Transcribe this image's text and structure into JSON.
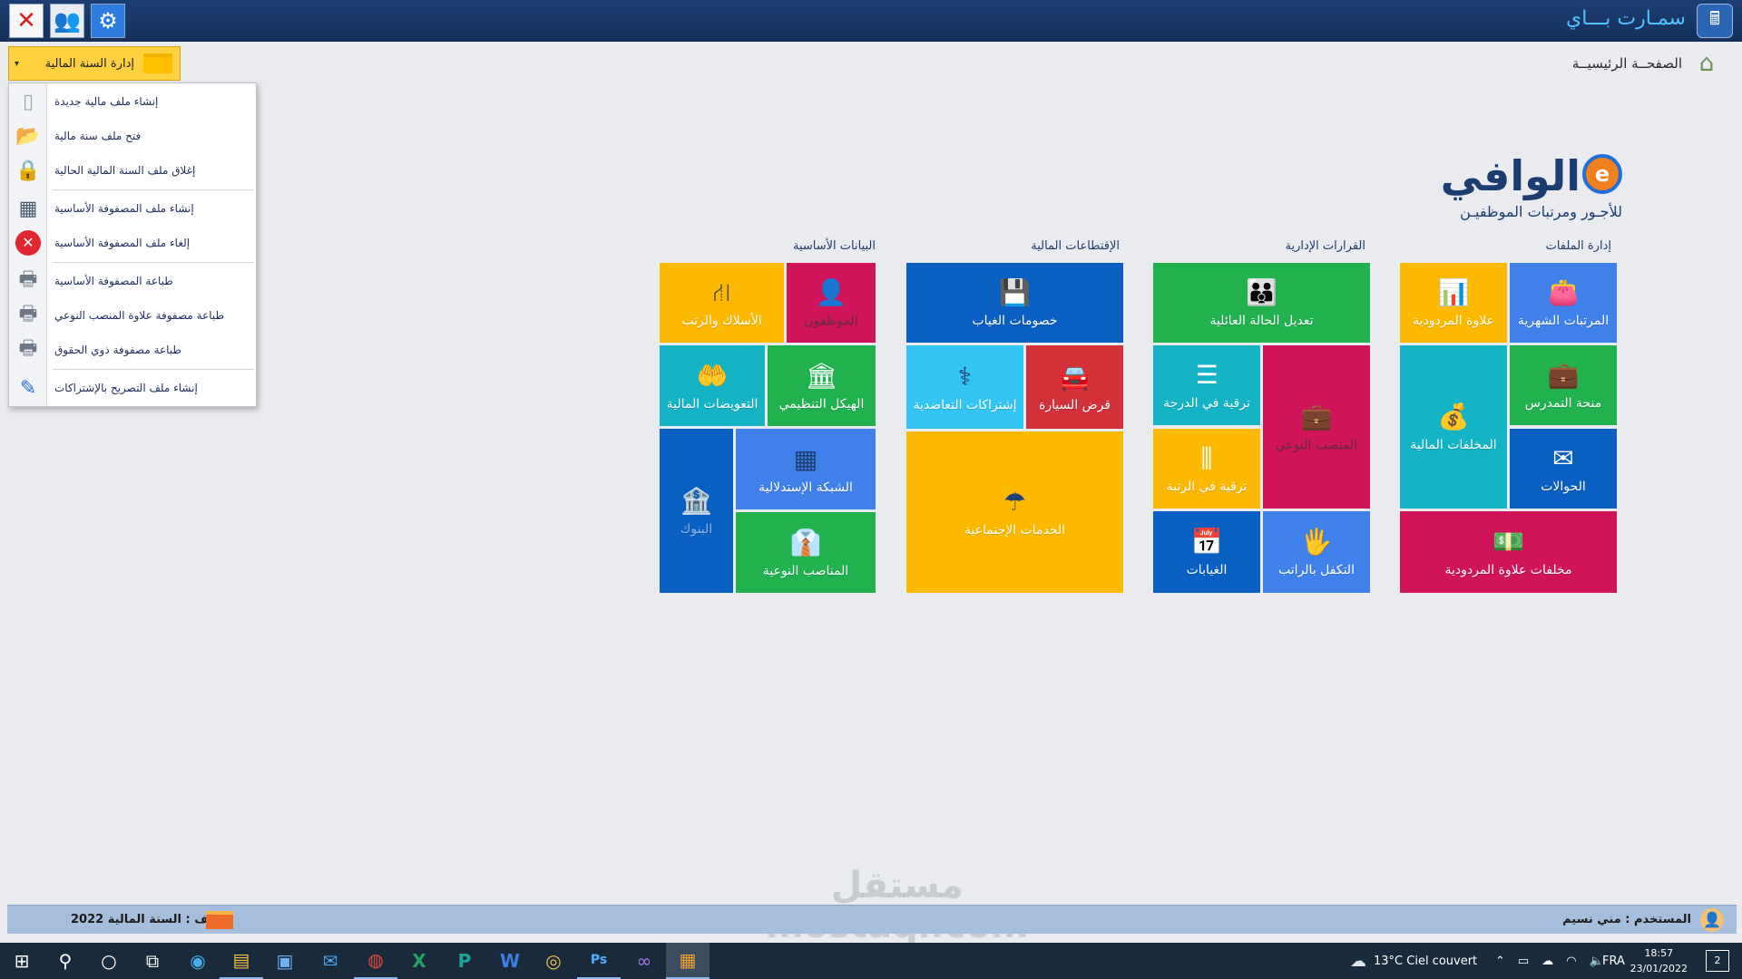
{
  "titlebar": {
    "app_title": "سمـارت بـــاي",
    "close_glyph": "✕",
    "users_glyph": "👥",
    "gear_glyph": "⚙",
    "app_logo_glyph": "🖩"
  },
  "toolbar": {
    "fiscal_year_button": "إدارة السنة المالية",
    "dropdown_arrow": "▾",
    "home_label": "الصفحــة الرئيسيــة",
    "home_glyph": "⌂"
  },
  "menu": {
    "items": [
      {
        "label": "إنشاء ملف مالية جديدة",
        "icon": "blank-page-icon",
        "glyph": "▯"
      },
      {
        "label": "فتح ملف  سنة مالية",
        "icon": "open-folder-icon",
        "glyph": "📂"
      },
      {
        "label": "إغلاق  ملف السنة المالية الحالية",
        "icon": "padlock-icon",
        "glyph": "🔒"
      },
      {
        "label": "إنشاء ملف المصفوفة الأساسية",
        "icon": "calculator-icon",
        "glyph": "▦"
      },
      {
        "label": "إلغاء ملف المصفوفة الأساسية",
        "icon": "cancel-icon",
        "glyph": "✕"
      },
      {
        "label": "طباعة المصفوفة الأساسية",
        "icon": "printer-icon",
        "glyph": "🖶"
      },
      {
        "label": "طباعة مصفوفة علاوة المنصب النوعي",
        "icon": "printer-icon",
        "glyph": "🖶"
      },
      {
        "label": "طباعة مصفوفة ذوي الحقوق",
        "icon": "printer-icon",
        "glyph": "🖶"
      },
      {
        "label": "إنشاء ملف التصريح بالإشتراكات",
        "icon": "notepad-icon",
        "glyph": "✎"
      }
    ]
  },
  "logo": {
    "name": "الوافي",
    "e_mark": "e",
    "subtitle": "للأجـور ومرتبات الموظفيـن"
  },
  "sections": {
    "files": "إدارة الملفات",
    "admin_decisions": "القرارات الإدارية",
    "deductions": "الإقتطاعات المالية",
    "basic_data": "البيانات الأساسية"
  },
  "tiles": {
    "monthly_salaries": {
      "label": "المرتبات الشهرية",
      "glyph": "👛"
    },
    "performance_bonus": {
      "label": "علاوة المردودية",
      "glyph": "📊"
    },
    "teaching_grant": {
      "label": "منحة التمدرس",
      "glyph": "💼"
    },
    "financial_arrears": {
      "label": "المخلفات المالية",
      "glyph": "💰"
    },
    "transfers": {
      "label": "الحوالات",
      "glyph": "✉"
    },
    "bonus_arrears": {
      "label": "مخلفات علاوة المردودية",
      "glyph": "💵"
    },
    "family_status": {
      "label": "تعديل الحالة العائلية",
      "glyph": "👪"
    },
    "grade_promotion": {
      "label": "ترقية في الدرجة",
      "glyph": "☰"
    },
    "specific_position": {
      "label": "المنصب النوعي",
      "glyph": "💼"
    },
    "rank_promotion": {
      "label": "ترقية في الرتبة",
      "glyph": "⫼"
    },
    "absences": {
      "label": "الغيابات",
      "glyph": "📅"
    },
    "salary_coverage": {
      "label": "التكفل بالراتب",
      "glyph": "🖐"
    },
    "absence_deductions": {
      "label": "خصومات الغياب",
      "glyph": "💾"
    },
    "mutual_subscriptions": {
      "label": "إشتراكات التعاضدية",
      "glyph": "⚕"
    },
    "car_loan": {
      "label": "قرض السيارة",
      "glyph": "🚘"
    },
    "social_services": {
      "label": "الخدمات الإجتماعية",
      "glyph": "☂"
    },
    "employees": {
      "label": "الموظفون",
      "glyph": "👤"
    },
    "corps_grades": {
      "label": "الأسلاك والرتب",
      "glyph": "⛙"
    },
    "org_structure": {
      "label": "الهيكل التنظيمي",
      "glyph": "🏛"
    },
    "financial_compensation": {
      "label": "التعويضات المالية",
      "glyph": "🤲"
    },
    "index_grid": {
      "label": "الشبكة الإستدلالية",
      "glyph": "▦"
    },
    "banks": {
      "label": "البنوك",
      "glyph": "🏦"
    },
    "specific_positions": {
      "label": "المناصب النوعية",
      "glyph": "👔"
    }
  },
  "statusbar": {
    "file": "الملف : السنة المالية 2022",
    "user": "المستخدم : مني نسيم",
    "user_glyph": "👤"
  },
  "taskbar": {
    "weather": "13°C  Ciel couvert",
    "language": "FRA",
    "time": "18:57",
    "date": "23/01/2022",
    "notifications": "2",
    "icons": [
      {
        "name": "windows-start-icon",
        "glyph": "⊞"
      },
      {
        "name": "search-icon",
        "glyph": "⚲"
      },
      {
        "name": "cortana-icon",
        "glyph": "○"
      },
      {
        "name": "task-view-icon",
        "glyph": "⧉"
      },
      {
        "name": "edge-icon",
        "glyph": "◉"
      },
      {
        "name": "file-explorer-icon",
        "glyph": "▤"
      },
      {
        "name": "store-icon",
        "glyph": "▣"
      },
      {
        "name": "mail-icon",
        "glyph": "✉"
      },
      {
        "name": "chrome-icon",
        "glyph": "◍"
      },
      {
        "name": "excel-icon",
        "glyph": "X"
      },
      {
        "name": "publisher-icon",
        "glyph": "P"
      },
      {
        "name": "word-icon",
        "glyph": "W"
      },
      {
        "name": "media-icon",
        "glyph": "◎"
      },
      {
        "name": "photoshop-icon",
        "glyph": "Ps"
      },
      {
        "name": "visual-studio-icon",
        "glyph": "∞"
      },
      {
        "name": "smart-pay-taskbar-icon",
        "glyph": "▦"
      }
    ]
  },
  "watermark": "مستقل\nmostaql.com"
}
